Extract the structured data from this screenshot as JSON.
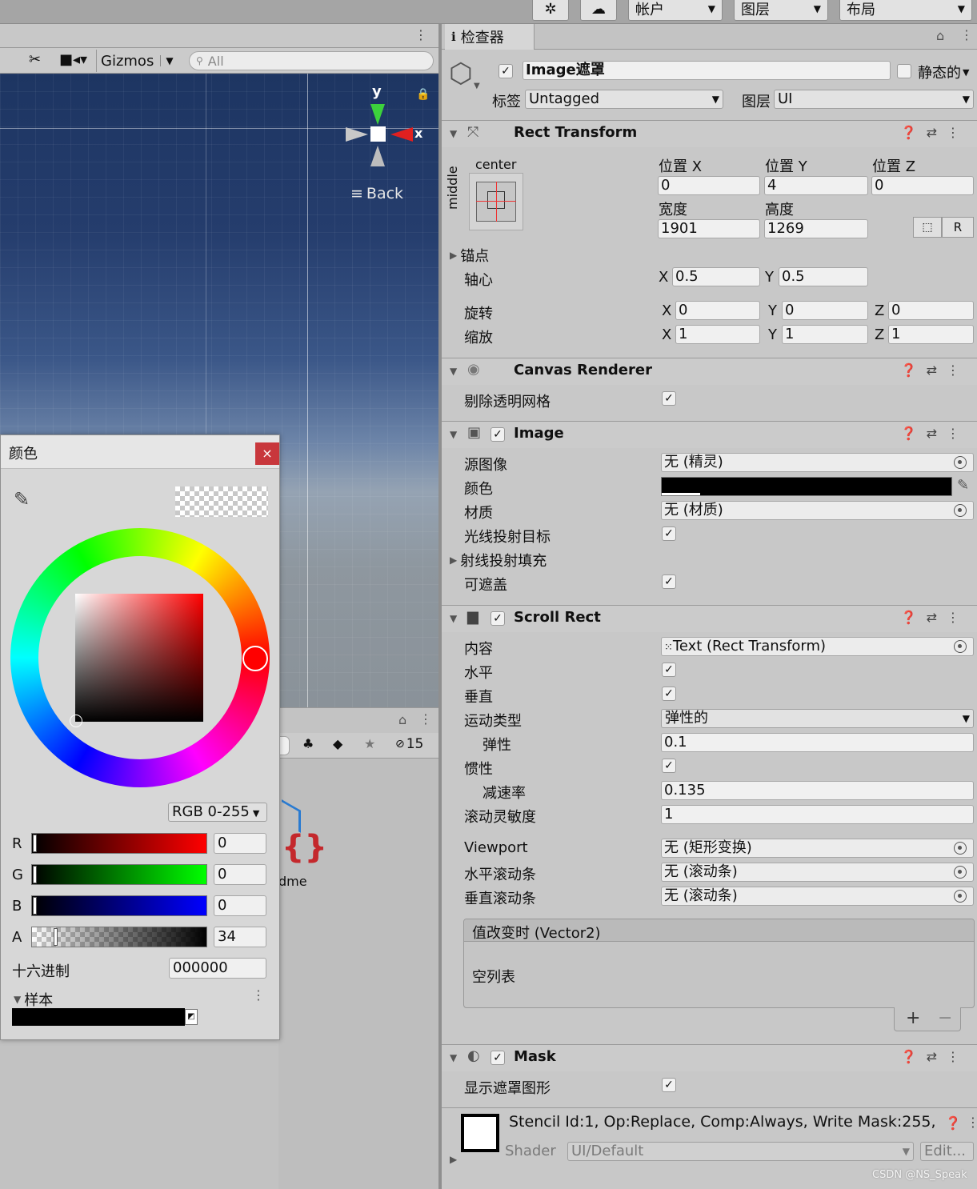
{
  "toolbar": {
    "account": "帐户",
    "layers": "图层",
    "layout": "布局"
  },
  "scene": {
    "gizmos": "Gizmos",
    "search_placeholder": "All",
    "axis_y": "y",
    "axis_x": "x",
    "back_label": "Back"
  },
  "project": {
    "hidden_count": "15",
    "file_label": "dme"
  },
  "color_picker": {
    "title": "颜色",
    "close": "×",
    "mode": "RGB 0-255",
    "r_label": "R",
    "r_value": "0",
    "g_label": "G",
    "g_value": "0",
    "b_label": "B",
    "b_value": "0",
    "a_label": "A",
    "a_value": "34",
    "hex_label": "十六进制",
    "hex_value": "000000",
    "swatches_label": "样本"
  },
  "inspector": {
    "tab_title": "检查器",
    "object_name": "Image遮罩",
    "static_label": "静态的",
    "tag_label": "标签",
    "tag_value": "Untagged",
    "layer_label": "图层",
    "layer_value": "UI",
    "rect_transform": {
      "title": "Rect Transform",
      "anchor_h": "center",
      "anchor_v": "middle",
      "pos_x_label": "位置 X",
      "pos_x": "0",
      "pos_y_label": "位置 Y",
      "pos_y": "4",
      "pos_z_label": "位置 Z",
      "pos_z": "0",
      "width_label": "宽度",
      "width": "1901",
      "height_label": "高度",
      "height": "1269",
      "r_button": "R",
      "anchors_label": "锚点",
      "pivot_label": "轴心",
      "pivot_x": "0.5",
      "pivot_y": "0.5",
      "rotation_label": "旋转",
      "rot_x": "0",
      "rot_y": "0",
      "rot_z": "0",
      "scale_label": "缩放",
      "scale_x": "1",
      "scale_y": "1",
      "scale_z": "1",
      "x": "X",
      "y": "Y",
      "z": "Z"
    },
    "canvas_renderer": {
      "title": "Canvas Renderer",
      "cull_label": "剔除透明网格"
    },
    "image": {
      "title": "Image",
      "source_label": "源图像",
      "source_value": "无 (精灵)",
      "color_label": "颜色",
      "material_label": "材质",
      "material_value": "无 (材质)",
      "raycast_label": "光线投射目标",
      "raycast_padding_label": "射线投射填充",
      "maskable_label": "可遮盖"
    },
    "scroll_rect": {
      "title": "Scroll Rect",
      "content_label": "内容",
      "content_value": "Text (Rect Transform)",
      "horizontal_label": "水平",
      "vertical_label": "垂直",
      "movement_label": "运动类型",
      "movement_value": "弹性的",
      "elasticity_label": "弹性",
      "elasticity_value": "0.1",
      "inertia_label": "惯性",
      "decel_label": "减速率",
      "decel_value": "0.135",
      "sensitivity_label": "滚动灵敏度",
      "sensitivity_value": "1",
      "viewport_label": "Viewport",
      "viewport_value": "无 (矩形变换)",
      "hscroll_label": "水平滚动条",
      "hscroll_value": "无 (滚动条)",
      "vscroll_label": "垂直滚动条",
      "vscroll_value": "无 (滚动条)",
      "event_title": "值改变时 (Vector2)",
      "event_empty": "空列表",
      "add": "+",
      "remove": "−"
    },
    "mask": {
      "title": "Mask",
      "show_label": "显示遮罩图形"
    },
    "material": {
      "stencil": "Stencil Id:1, Op:Replace, Comp:Always, Write Mask:255,",
      "shader_label": "Shader",
      "shader_value": "UI/Default",
      "edit": "Edit..."
    },
    "watermark": "CSDN @NS_Speak"
  },
  "colors": {
    "scene_top": "#1d3562",
    "close_red": "#c8373c",
    "hue_indicator": "#ff0000"
  }
}
